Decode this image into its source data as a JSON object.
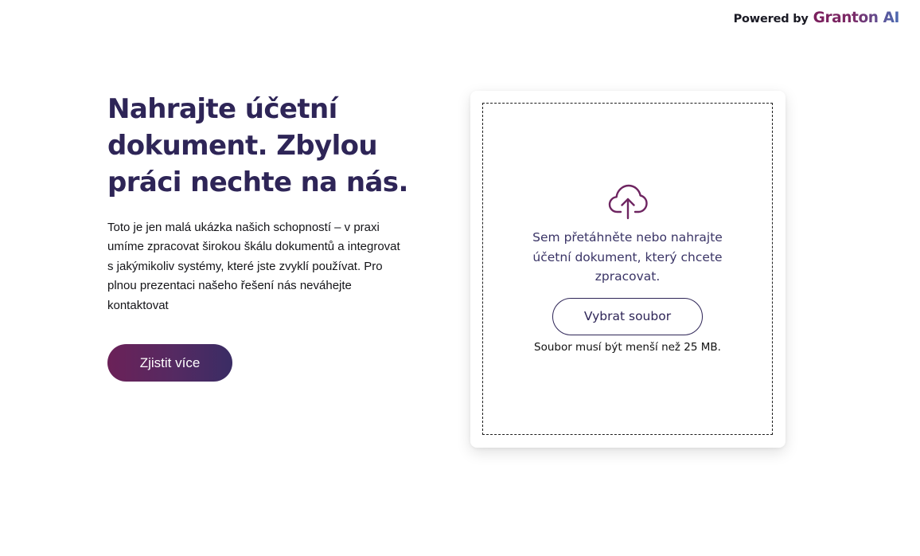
{
  "header": {
    "powered_label": "Powered by",
    "brand_name": "Granton AI",
    "brand_gradient": [
      "#7a1e5c",
      "#4b6ab2"
    ]
  },
  "hero": {
    "headline": "Nahrajte účetní dokument. Zbylou práci nechte na nás.",
    "description": "Toto je jen malá ukázka našich schopností – v praxi umíme zpracovat širokou škálu dokumentů a integrovat s jakýmikoliv systémy, které jste zvyklí používat. Pro plnou prezentaci našeho řešení nás neváhejte kontaktovat",
    "cta_label": "Zjistit více"
  },
  "upload": {
    "icon": "cloud-upload-icon",
    "instruction": "Sem přetáhněte nebo nahrajte účetní dokument, který chcete zpracovat.",
    "button_label": "Vybrat soubor",
    "size_note": "Soubor musí být menší než 25 MB."
  },
  "colors": {
    "primary_text": "#2e2557",
    "accent_purple": "#6b2158",
    "icon_color": "#6e2561"
  }
}
